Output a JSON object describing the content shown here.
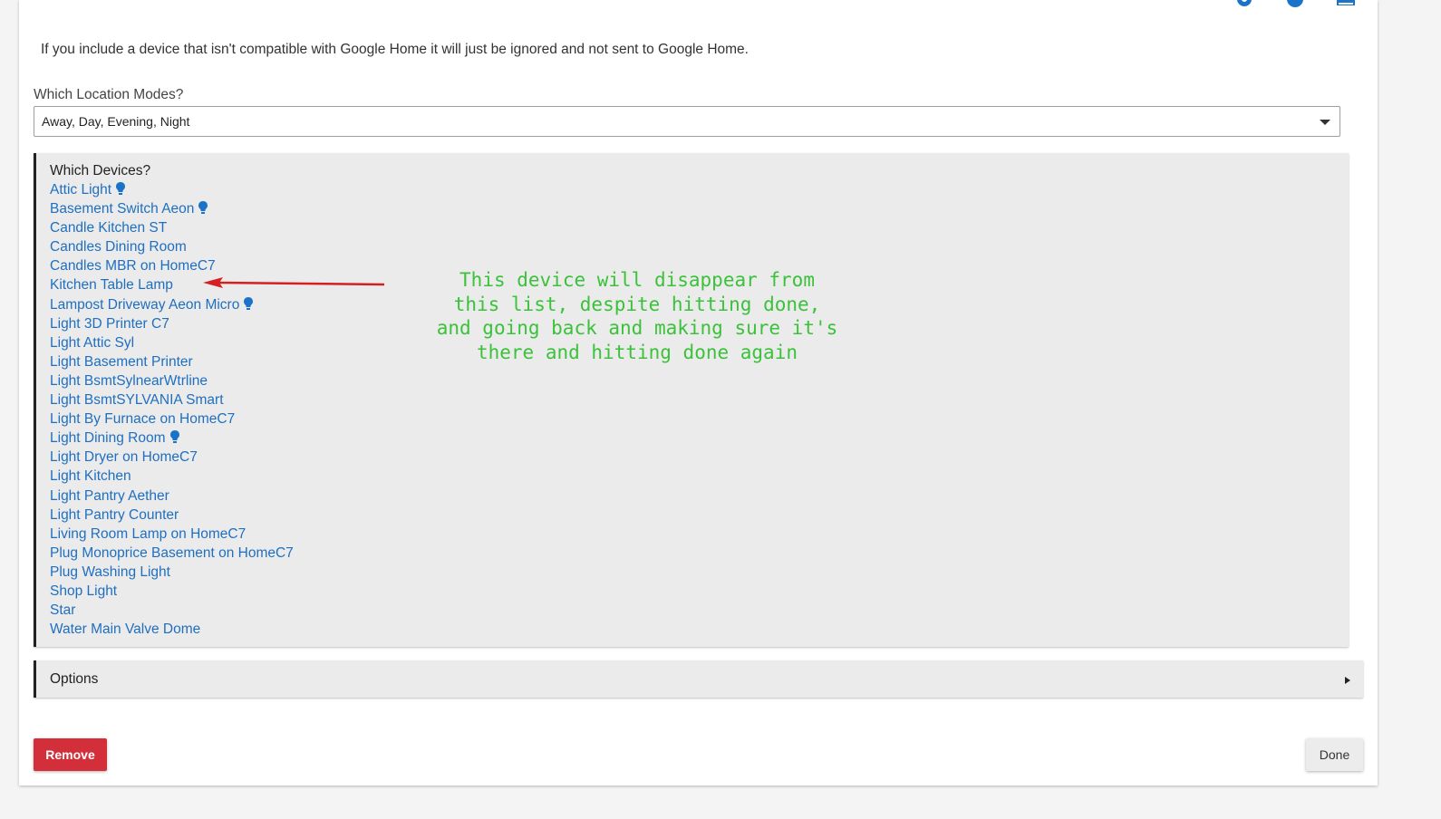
{
  "info_text": "If you include a device that isn't compatible with Google Home it will just be ignored and not sent to Google Home.",
  "location_modes": {
    "label": "Which Location Modes?",
    "selected": "Away, Day, Evening, Night"
  },
  "devices": {
    "label": "Which Devices?",
    "items": [
      {
        "label": "Attic Light",
        "icon": "bulb-icon"
      },
      {
        "label": "Basement Switch Aeon",
        "icon": "bulb-icon"
      },
      {
        "label": "Candle Kitchen ST"
      },
      {
        "label": "Candles Dining Room"
      },
      {
        "label": "Candles MBR on HomeC7"
      },
      {
        "label": "Kitchen Table Lamp"
      },
      {
        "label": "Lampost Driveway Aeon Micro",
        "icon": "bulb-icon"
      },
      {
        "label": "Light 3D Printer C7"
      },
      {
        "label": "Light Attic Syl"
      },
      {
        "label": "Light Basement Printer"
      },
      {
        "label": "Light BsmtSylnearWtrline"
      },
      {
        "label": "Light BsmtSYLVANIA Smart"
      },
      {
        "label": "Light By Furnace on HomeC7"
      },
      {
        "label": "Light Dining Room",
        "icon": "bulb-icon"
      },
      {
        "label": "Light Dryer on HomeC7"
      },
      {
        "label": "Light Kitchen"
      },
      {
        "label": "Light Pantry Aether"
      },
      {
        "label": "Light Pantry Counter"
      },
      {
        "label": "Living Room Lamp on HomeC7"
      },
      {
        "label": "Plug Monoprice Basement on HomeC7"
      },
      {
        "label": "Plug Washing Light"
      },
      {
        "label": "Shop Light"
      },
      {
        "label": "Star"
      },
      {
        "label": "Water Main Valve Dome"
      }
    ]
  },
  "annotation": {
    "text": "This device will disappear from\nthis list, despite hitting done,\nand going back and making sure it's\nthere and hitting done again",
    "color": "#3ac23a",
    "arrow_color": "#d42020"
  },
  "options": {
    "label": "Options"
  },
  "buttons": {
    "remove": "Remove",
    "done": "Done"
  },
  "colors": {
    "link": "#1f6fc0",
    "remove": "#d32f3b",
    "panel": "#ebebeb"
  }
}
